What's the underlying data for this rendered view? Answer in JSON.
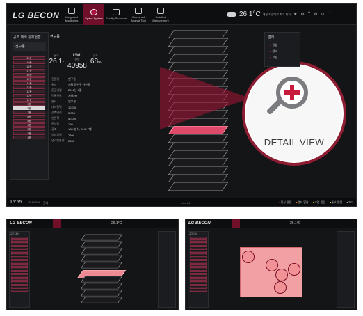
{
  "app": {
    "brand": "LG BECON",
    "nav": [
      {
        "label": "Integrated Monitoring",
        "icon": "monitor-icon",
        "active": false
      },
      {
        "label": "Space System",
        "icon": "space-icon",
        "active": true
      },
      {
        "label": "Facility Structure",
        "icon": "facility-icon",
        "active": false
      },
      {
        "label": "Combined Analyst Tool",
        "icon": "chart-icon",
        "active": false
      },
      {
        "label": "Detailed Management",
        "icon": "gear-icon",
        "active": false
      }
    ],
    "weather": {
      "temp": "26.1°C",
      "small": "계절 기상예보\n최고 최저"
    },
    "tools": [
      "★",
      "⚙",
      "?",
      "⚙",
      "⊙",
      "⌃"
    ]
  },
  "left_panel": {
    "title": "공조 대비 통제현황",
    "tab": "전구동",
    "selected_floor_index": 12,
    "floors": [
      "20층",
      "19층",
      "18층",
      "17층",
      "16층",
      "15층",
      "14층",
      "13층",
      "12층",
      "11층",
      "10층",
      "9층",
      "8층",
      "7층",
      "6층",
      "5층",
      "4층",
      "3층",
      "2층",
      "1층"
    ]
  },
  "stats": {
    "title": "현구동",
    "items": [
      {
        "label": "온도",
        "value": "26.1",
        "unit": "°"
      },
      {
        "label": "전력",
        "value": "40958",
        "unit": "kWh"
      },
      {
        "label": "습도",
        "value": "68",
        "unit": "%"
      }
    ],
    "rows": [
      [
        "건물명",
        "현구동"
      ],
      [
        "위치",
        "서울 금천구 가산동"
      ],
      [
        "준공년월",
        "2016년 1월"
      ],
      [
        "건물규모",
        "지하2층"
      ],
      [
        "용도",
        "업무용"
      ],
      [
        "대지면적",
        "10,000"
      ],
      [
        "건축면적",
        "5,000"
      ],
      [
        "연면적",
        "50,000"
      ],
      [
        "주차장",
        "100"
      ],
      [
        "공조",
        "VAV 방식, AHU 7대"
      ],
      [
        "냉방능력",
        "750t"
      ],
      [
        "냉각탑용량",
        "2500"
      ]
    ]
  },
  "right_panel": {
    "title": "범례",
    "items": [
      "정상",
      "경보",
      "고장"
    ]
  },
  "detail_callout": {
    "label": "DETAIL VIEW"
  },
  "status_bar": {
    "time": "15:55",
    "date": "2016/03/24",
    "user": "관리",
    "center": "Line 84",
    "legends": [
      "정상 알람",
      "경보 알람",
      "고장 알람",
      "통보 알람",
      "기타"
    ]
  },
  "sub_left": {
    "brand": "LG BECON",
    "weather": "26.1°C",
    "panel_title": "공조 대비"
  },
  "sub_right": {
    "brand": "LG BECON",
    "weather": "26.1°C",
    "panel_title": "공조 대비"
  }
}
